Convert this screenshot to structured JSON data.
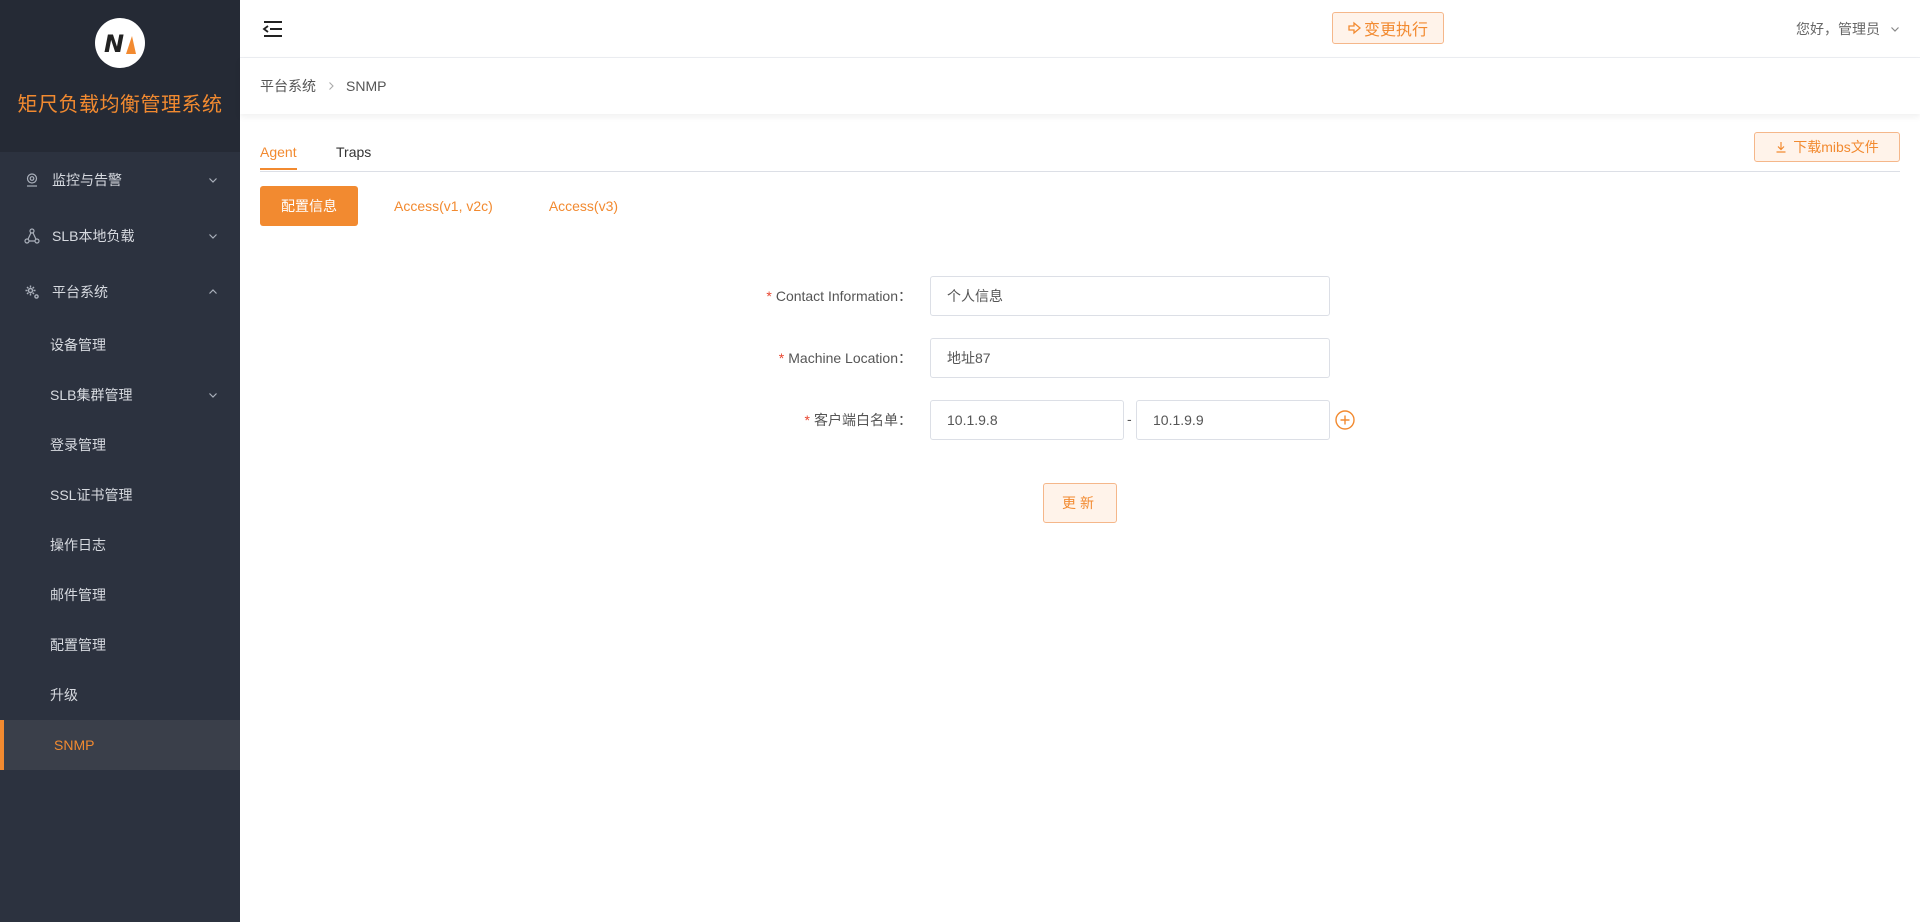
{
  "app": {
    "title": "矩尺负载均衡管理系统",
    "brand_color": "#f28a30",
    "sidebar_bg": "#2c323f"
  },
  "sidebar": {
    "groups": [
      {
        "label": "监控与告警",
        "icon": "location-pin-icon",
        "expanded": false
      },
      {
        "label": "SLB本地负载",
        "icon": "network-nodes-icon",
        "expanded": false
      },
      {
        "label": "平台系统",
        "icon": "gear-icon",
        "expanded": true
      }
    ],
    "sub_items": [
      {
        "label": "设备管理"
      },
      {
        "label": "SLB集群管理",
        "has_children": true
      },
      {
        "label": "登录管理"
      },
      {
        "label": "SSL证书管理"
      },
      {
        "label": "操作日志"
      },
      {
        "label": "邮件管理"
      },
      {
        "label": "配置管理"
      },
      {
        "label": "升级"
      },
      {
        "label": "SNMP",
        "active": true
      }
    ]
  },
  "header": {
    "exec_button": "变更执行",
    "user_greeting": "您好，管理员"
  },
  "breadcrumb": [
    "平台系统",
    "SNMP"
  ],
  "tabs": [
    {
      "label": "Agent",
      "active": true
    },
    {
      "label": "Traps",
      "active": false
    }
  ],
  "download_button": "下载mibs文件",
  "subtabs": [
    {
      "label": "配置信息",
      "active": true
    },
    {
      "label": "Access(v1, v2c)",
      "active": false
    },
    {
      "label": "Access(v3)",
      "active": false
    }
  ],
  "form": {
    "contact": {
      "label": "Contact Information：",
      "value": "个人信息"
    },
    "location": {
      "label": "Machine Location：",
      "value": "地址87"
    },
    "whitelist": {
      "label": "客户端白名单：",
      "start": "10.1.9.8",
      "separator": "-",
      "end": "10.1.9.9"
    },
    "required_mark": "*",
    "submit": "更新"
  }
}
